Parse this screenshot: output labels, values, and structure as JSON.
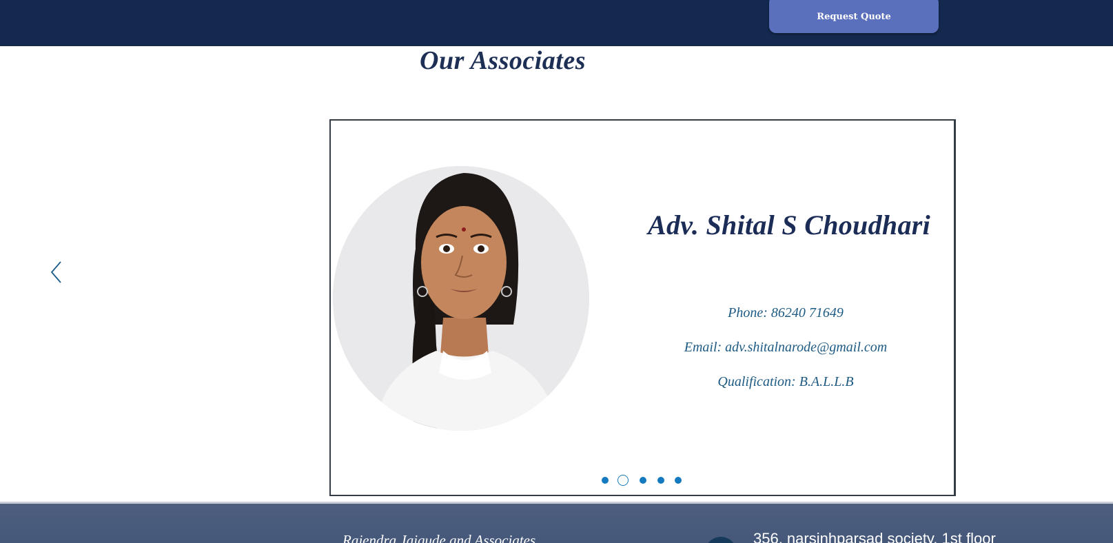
{
  "header": {
    "request_quote_label": "Request Quote"
  },
  "section": {
    "title": "Our Associates"
  },
  "slide": {
    "name": "Adv. Shital S Choudhari",
    "phone": "Phone: 86240 71649",
    "email": "Email:  adv.shitalnarode@gmail.com",
    "qualification": "Qualification:  B.A.L.L.B"
  },
  "slider": {
    "slide_count": 5,
    "active_index": 2
  },
  "footer": {
    "brand": "Rajendra Jaigude and Associates",
    "address": "356, narsinhparsad society, 1st floor"
  },
  "colors": {
    "header_bg": "#13294e",
    "button_bg": "#5b70bd",
    "title_text": "#1e2f55",
    "detail_text": "#1d5a83",
    "dot_blue": "#1579bf",
    "footer_bg": "#4e5f7e"
  },
  "icons": {
    "prev": "chevron-left-icon"
  }
}
